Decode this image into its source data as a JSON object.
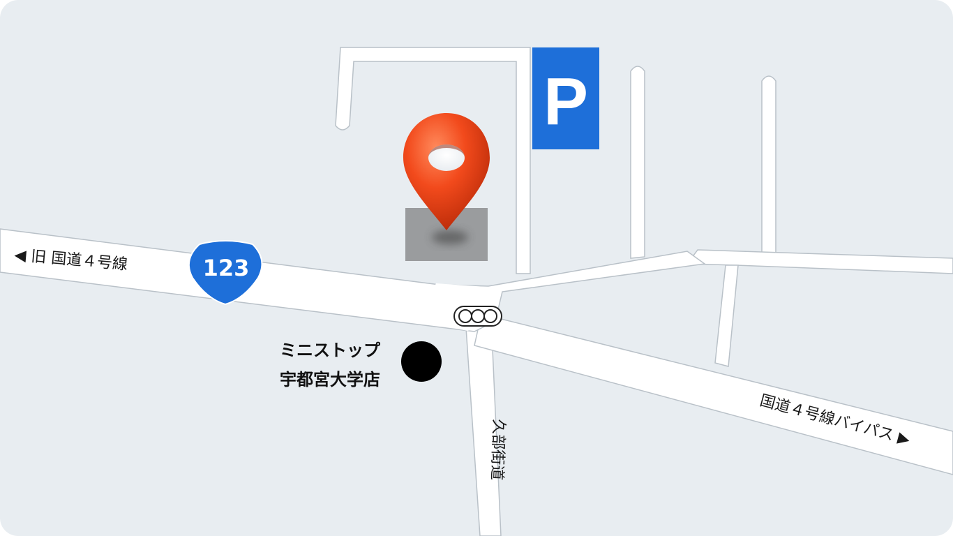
{
  "map": {
    "background_color": "#e8edf1",
    "road_color": "#ffffff",
    "road_edge_color": "#b9c1c8",
    "roads": {
      "old_route4_label": "◀ 旧 国道４号線",
      "bypass_label": "国道４号線バイパス ▶",
      "kube_kaido_label": "久部街道"
    },
    "route_shield": {
      "number": "123",
      "color": "#1e6fd9",
      "icon": "national-route-shield-icon"
    },
    "parking": {
      "letter": "P",
      "color": "#1e6fd9",
      "icon": "parking-icon"
    },
    "destination": {
      "icon": "location-pin-icon",
      "pin_color": "#f04a1e",
      "building_color": "#9a9c9e"
    },
    "traffic_signal": {
      "icon": "traffic-signal-icon"
    },
    "landmark": {
      "name_line1": "ミニストップ",
      "name_line2": "宇都宮大学店",
      "icon": "landmark-dot-icon",
      "dot_color": "#000000"
    }
  }
}
